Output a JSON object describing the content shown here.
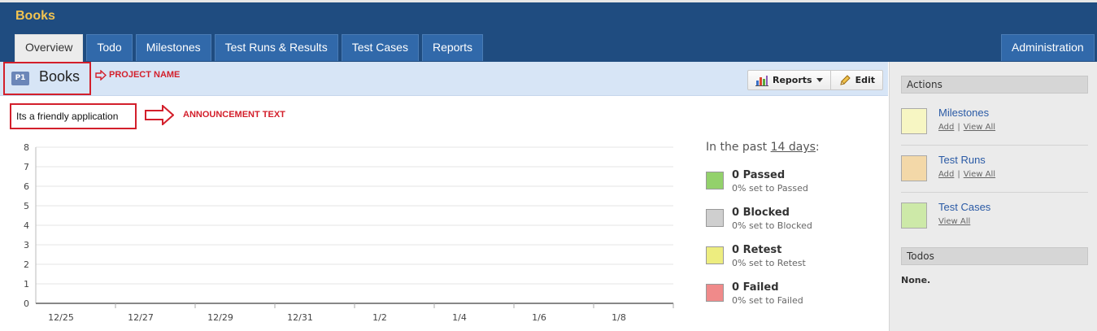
{
  "app": {
    "title": "Books"
  },
  "tabs": [
    {
      "label": "Overview",
      "active": true
    },
    {
      "label": "Todo"
    },
    {
      "label": "Milestones"
    },
    {
      "label": "Test Runs & Results"
    },
    {
      "label": "Test Cases"
    },
    {
      "label": "Reports"
    }
  ],
  "admin_tab": {
    "label": "Administration"
  },
  "project": {
    "badge": "P1",
    "name": "Books"
  },
  "annotations": {
    "project_name": "PROJECT NAME",
    "announcement": "ANNOUNCEMENT TEXT"
  },
  "toolbar": {
    "reports_label": "Reports",
    "edit_label": "Edit"
  },
  "announcement": {
    "text": "Its a friendly application"
  },
  "chart_data": {
    "type": "line",
    "categories": [
      "12/25",
      "12/27",
      "12/29",
      "12/31",
      "1/2",
      "1/4",
      "1/6",
      "1/8"
    ],
    "y_ticks": [
      "0",
      "1",
      "2",
      "3",
      "4",
      "5",
      "6",
      "7",
      "8"
    ],
    "ylim": [
      0,
      8
    ],
    "series": [],
    "grid": true
  },
  "legend": {
    "heading_prefix": "In the past",
    "heading_days": "14 days",
    "heading_suffix": ":",
    "items": [
      {
        "title": "0 Passed",
        "sub": "0% set to Passed",
        "color": "#93d16b"
      },
      {
        "title": "0 Blocked",
        "sub": "0% set to Blocked",
        "color": "#cfcfcf"
      },
      {
        "title": "0 Retest",
        "sub": "0% set to Retest",
        "color": "#eded7f"
      },
      {
        "title": "0 Failed",
        "sub": "0% set to Failed",
        "color": "#f08a8a"
      }
    ]
  },
  "sidebar": {
    "actions_heading": "Actions",
    "items": [
      {
        "title": "Milestones",
        "add": "Add",
        "sep": "|",
        "view_all": "View All",
        "color": "#f7f6c3"
      },
      {
        "title": "Test Runs",
        "add": "Add",
        "sep": "|",
        "view_all": "View All",
        "color": "#f3d8a8"
      },
      {
        "title": "Test Cases",
        "view_all": "View All",
        "color": "#cde9a8"
      }
    ],
    "todos_heading": "Todos",
    "todos_empty": "None."
  }
}
